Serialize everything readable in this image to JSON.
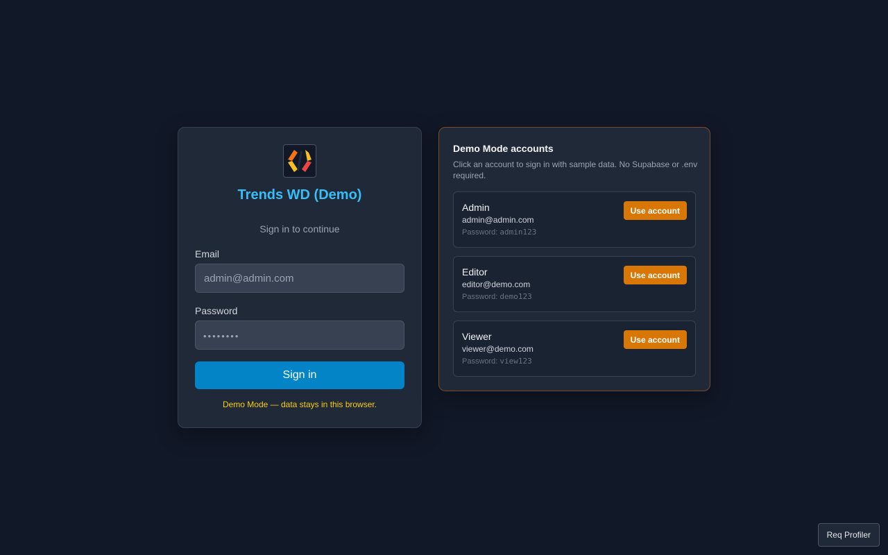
{
  "login": {
    "logo_icon": "code-brackets-logo-icon",
    "app_title": "Trends WD (Demo)",
    "subtitle": "Sign in to continue",
    "email_label": "Email",
    "email_placeholder": "admin@admin.com",
    "password_label": "Password",
    "password_mask": "••••••••",
    "signin_label": "Sign in",
    "demo_note": "Demo Mode — data stays in this browser."
  },
  "accounts_panel": {
    "title": "Demo Mode accounts",
    "description": "Click an account to sign in with sample data. No Supabase or .env required.",
    "password_prefix": "Password: ",
    "accounts": [
      {
        "name": "Admin",
        "email": "admin@admin.com",
        "password": "admin123",
        "button_label": "Use account"
      },
      {
        "name": "Editor",
        "email": "editor@demo.com",
        "password": "demo123",
        "button_label": "Use account"
      },
      {
        "name": "Viewer",
        "email": "viewer@demo.com",
        "password": "view123",
        "button_label": "Use account"
      }
    ]
  },
  "req_profiler_label": "Req Profiler",
  "colors": {
    "background": "#111827",
    "card": "#1f2937",
    "title_accent": "#38bdf8",
    "primary_button": "#0284c7",
    "account_button": "#d97706",
    "demo_note": "#facc15"
  }
}
